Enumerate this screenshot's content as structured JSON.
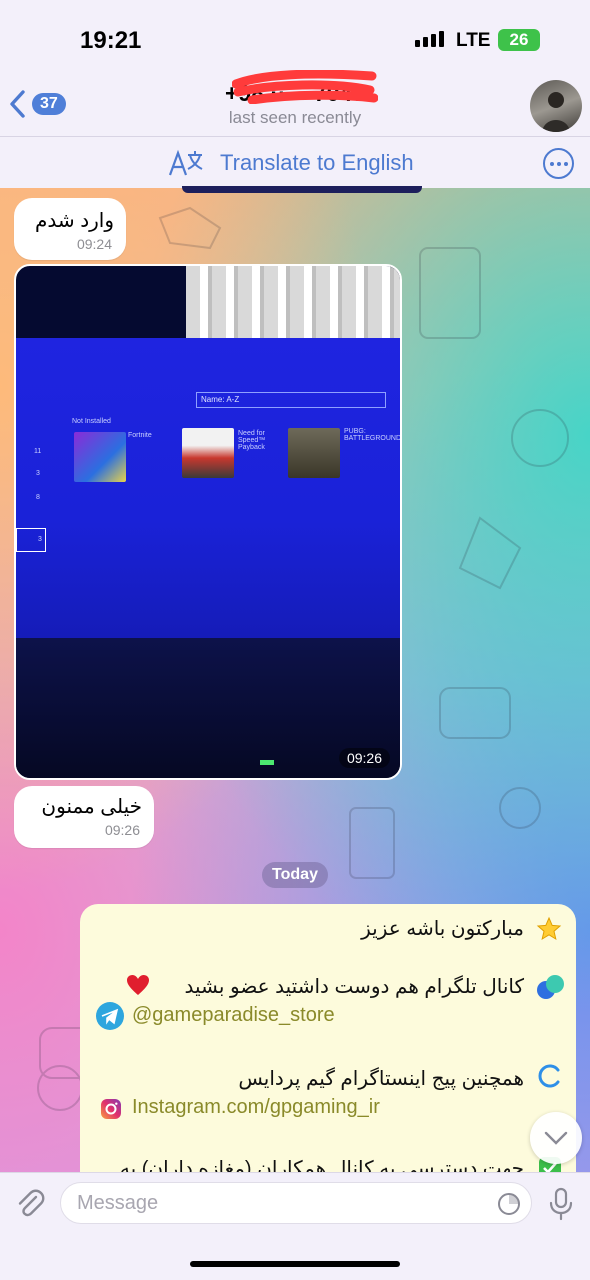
{
  "status_bar": {
    "time": "19:21",
    "network": "LTE",
    "battery": "26"
  },
  "header": {
    "back_count": "37",
    "title": "+98 ·· ·· 7043",
    "subtitle": "last seen recently"
  },
  "translate_bar": {
    "label": "Translate to English"
  },
  "messages": [
    {
      "text": "وارد شدم",
      "time": "09:24"
    },
    {
      "type": "photo",
      "time": "09:26",
      "screen": {
        "sort": "Name: A-Z",
        "not_installed": "Not Installed",
        "games": [
          "Fortnite",
          "Need for Speed™ Payback",
          "PUBG: BATTLEGROUNDS"
        ],
        "rows": [
          "11",
          "3",
          "8",
          "3"
        ]
      }
    },
    {
      "text": "خیلی ممنون",
      "time": "09:26"
    }
  ],
  "date_separator": "Today",
  "incoming": {
    "line1": "مبارکتون باشه عزیز",
    "line2": "کانال تلگرام هم دوست داشتید عضو بشید",
    "link1": "@gameparadise_store",
    "line3": "همچنین پیج اینستاگرام گیم پردایس",
    "link2": "Instagram.com/gpgaming_ir",
    "line4": "جهت دسترسی به کانال همکاران (مغازه داران) به"
  },
  "input": {
    "placeholder": "Message"
  },
  "colors": {
    "accent": "#4d7ad0",
    "badge": "#4f7fd8",
    "battery": "#3ec24a"
  }
}
